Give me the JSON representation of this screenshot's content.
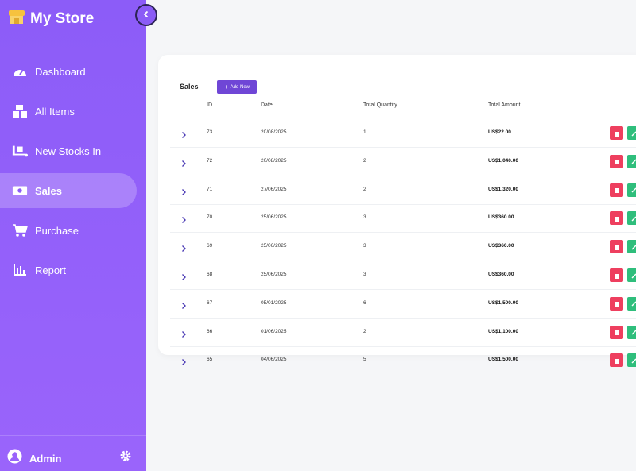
{
  "brand": {
    "name": "My Store",
    "icon": "store-icon"
  },
  "nav": [
    {
      "label": "Dashboard",
      "icon": "speedometer-icon",
      "active": false
    },
    {
      "label": "All Items",
      "icon": "boxes-icon",
      "active": false
    },
    {
      "label": "New Stocks In",
      "icon": "truck-loading-icon",
      "active": false
    },
    {
      "label": "Sales",
      "icon": "money-bill-icon",
      "active": true
    },
    {
      "label": "Purchase",
      "icon": "cart-icon",
      "active": false
    },
    {
      "label": "Report",
      "icon": "bar-chart-icon",
      "active": false
    }
  ],
  "user": {
    "name": "Admin",
    "icon": "user-circle-icon"
  },
  "settings_icon": "gear-icon",
  "collapse_icon": "chevron-left-icon",
  "sales": {
    "title": "Sales",
    "add_label": "Add New",
    "columns": [
      "ID",
      "Date",
      "Total Quantity",
      "Total Amount"
    ],
    "rows": [
      {
        "id": "73",
        "date": "20/08/2025",
        "qty": "1",
        "amount": "US$22.00"
      },
      {
        "id": "72",
        "date": "20/08/2025",
        "qty": "2",
        "amount": "US$1,040.00"
      },
      {
        "id": "71",
        "date": "27/06/2025",
        "qty": "2",
        "amount": "US$1,320.00"
      },
      {
        "id": "70",
        "date": "25/06/2025",
        "qty": "3",
        "amount": "US$360.00"
      },
      {
        "id": "69",
        "date": "25/06/2025",
        "qty": "3",
        "amount": "US$360.00"
      },
      {
        "id": "68",
        "date": "25/06/2025",
        "qty": "3",
        "amount": "US$360.00"
      },
      {
        "id": "67",
        "date": "05/01/2025",
        "qty": "6",
        "amount": "US$1,500.00"
      },
      {
        "id": "66",
        "date": "01/06/2025",
        "qty": "2",
        "amount": "US$1,100.00"
      },
      {
        "id": "65",
        "date": "04/06/2025",
        "qty": "5",
        "amount": "US$1,500.00"
      }
    ]
  },
  "colors": {
    "sidebar": "#8c5cf8",
    "accent": "#6f46d6",
    "delete": "#ee3f5f",
    "edit": "#2fbe7c",
    "brand_icon": "#f6c23e"
  }
}
